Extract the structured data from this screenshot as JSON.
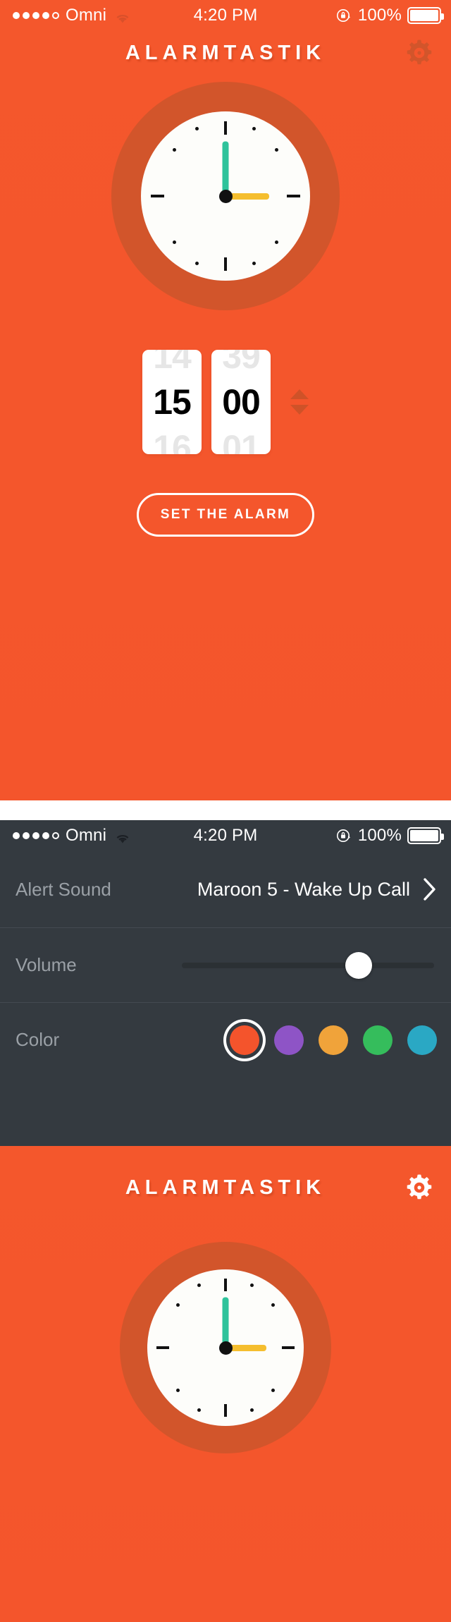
{
  "app": {
    "title": "ALARMTASTIK",
    "theme_accent": "#f4542c",
    "theme_accent_dark": "#cf5228",
    "panel_bg": "#343a40"
  },
  "status_bar": {
    "carrier": "Omni",
    "signal_dots_filled": 4,
    "signal_dots_total": 5,
    "wifi_icon": "wifi-icon",
    "time": "4:20 PM",
    "lock_icon": "rotation-lock-icon",
    "battery_percent": "100%",
    "battery_icon": "battery-full-icon"
  },
  "header": {
    "title": "ALARMTASTIK",
    "gear_icon": "gear-icon"
  },
  "analog_clock": {
    "hour_hand_color": "#f5be2e",
    "minute_hand_color": "#2fc39b",
    "hub_color": "#111111",
    "face_color": "#fdfdfa",
    "ring_color": "#d2552b",
    "displayed_time": "3:00",
    "hour_hand_angle_deg": 90,
    "minute_hand_angle_deg": 0
  },
  "time_picker": {
    "hour": {
      "value": "15",
      "prev": "14",
      "next": "16"
    },
    "minute": {
      "value": "00",
      "prev": "39",
      "next": "01"
    },
    "stepper_up_icon": "triangle-up-icon",
    "stepper_down_icon": "triangle-down-icon"
  },
  "set_alarm_button": {
    "label": "SET THE ALARM"
  },
  "settings": {
    "alert_sound": {
      "label": "Alert Sound",
      "value": "Maroon 5 - Wake Up Call",
      "chevron_icon": "chevron-right-icon"
    },
    "volume": {
      "label": "Volume",
      "value_percent": 70,
      "fill_color": "#f4542c",
      "track_color": "#2b3034"
    },
    "color": {
      "label": "Color",
      "selected_index": 0,
      "options": [
        {
          "name": "orange",
          "hex": "#f4542c"
        },
        {
          "name": "purple",
          "hex": "#8e54c6"
        },
        {
          "name": "amber",
          "hex": "#f0a33a"
        },
        {
          "name": "green",
          "hex": "#35bd5c"
        },
        {
          "name": "teal",
          "hex": "#2aa8c4"
        }
      ]
    }
  }
}
